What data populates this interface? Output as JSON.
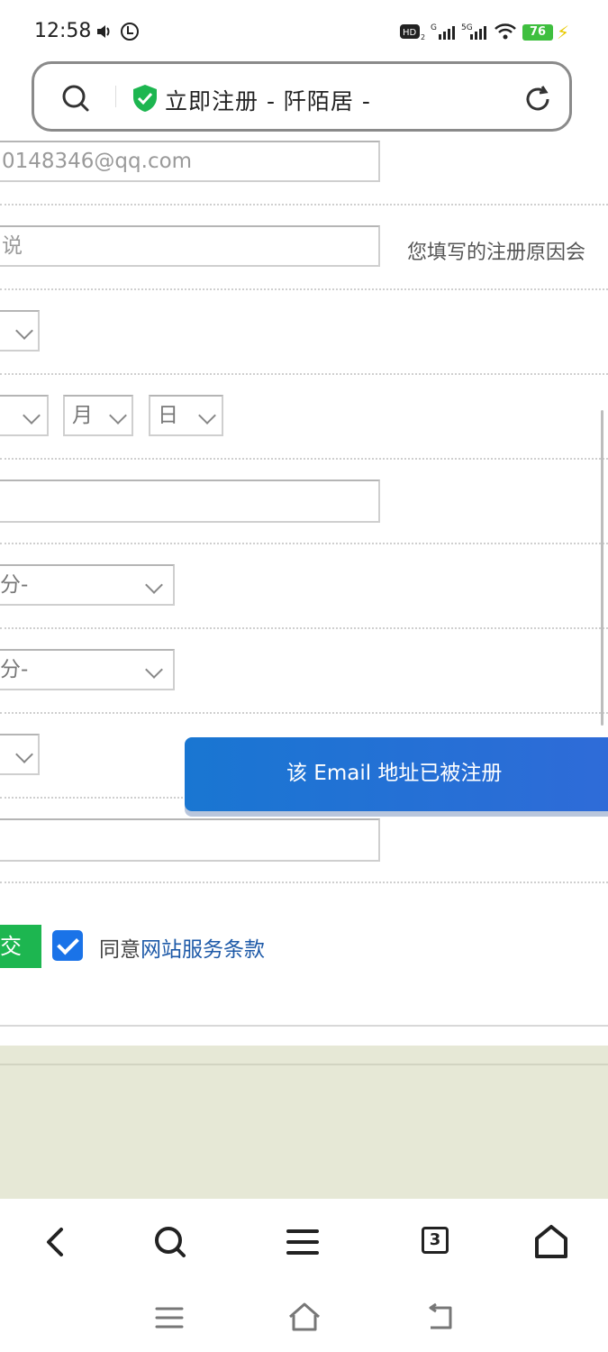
{
  "status_bar": {
    "time": "12:58",
    "battery": "76",
    "icons": [
      "volume-icon",
      "vpn-icon",
      "hd-icon",
      "signal-icon",
      "5g-signal-icon",
      "wifi-icon",
      "battery-icon",
      "charging-icon"
    ]
  },
  "address_bar": {
    "title": "立即注册 - 阡陌居 -",
    "icons": [
      "search-icon",
      "shield-check-icon",
      "reload-icon"
    ]
  },
  "form": {
    "email_value": "0148346@qq.com",
    "reason_placeholder": "说",
    "reason_hint": "您填写的注册原因会",
    "gender_select": "",
    "birth_year_select": "",
    "birth_month_select": "月",
    "birth_day_select": "日",
    "province_select_1": "分-",
    "province_select_2": "分-",
    "extra_select": "",
    "submit_label": "交",
    "agree_prefix": "同意",
    "agree_link": "网站服务条款"
  },
  "toast": {
    "message": "该 Email 地址已被注册"
  },
  "browser_nav": {
    "tab_count": "3",
    "icons": [
      "back-icon",
      "search-icon",
      "menu-icon",
      "tabs-icon",
      "home-icon"
    ]
  },
  "system_nav": {
    "icons": [
      "recents-icon",
      "home-icon",
      "back-icon"
    ]
  },
  "colors": {
    "accent": "#1a73e8",
    "submit": "#1db650",
    "toast": "#1976d2",
    "footer": "#e6e8d6"
  }
}
